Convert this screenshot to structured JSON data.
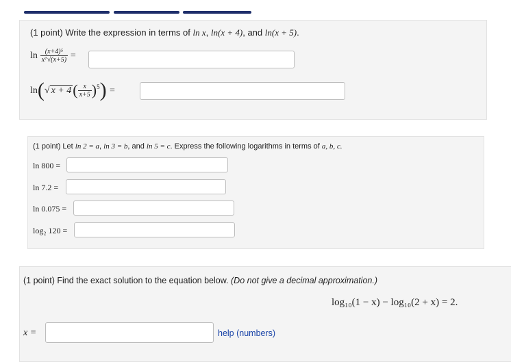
{
  "problem1": {
    "points": "(1 point)",
    "prompt_prefix": "Write the expression in terms of",
    "terms": [
      "ln x",
      "ln(x + 4)",
      "ln(x + 5)"
    ],
    "and_word": "and",
    "expr1": {
      "ln": "ln",
      "numerator": "(x+4)⁵",
      "denominator": "x⁷√(x+5)",
      "equals": "=",
      "answer": ""
    },
    "expr2": {
      "ln": "ln",
      "radicand": "x + 4",
      "inner_num": "x",
      "inner_den": "x+5",
      "power": "5",
      "equals": "=",
      "answer": ""
    }
  },
  "problem2": {
    "points": "(1 point)",
    "prompt_let": "Let",
    "given": [
      "ln 2 = a",
      "ln 3 = b",
      "ln 5 = c"
    ],
    "and_word": "and",
    "prompt_rest": "Express the following logarithms in terms of",
    "vars": "a, b, c.",
    "items": [
      {
        "label": "ln 800 =",
        "answer": ""
      },
      {
        "label": "ln 7.2 =",
        "answer": ""
      },
      {
        "label": "ln 0.075 =",
        "answer": ""
      },
      {
        "label": "log₂ 120 =",
        "answer": ""
      }
    ]
  },
  "problem3": {
    "points": "(1 point)",
    "prompt": "Find the exact solution to the equation below.",
    "note": "(Do not give a decimal approximation.)",
    "equation": "log₁₀(1 − x) − log₁₀(2 + x) = 2.",
    "var_label": "x =",
    "answer": "",
    "help_link": "help (numbers)"
  }
}
